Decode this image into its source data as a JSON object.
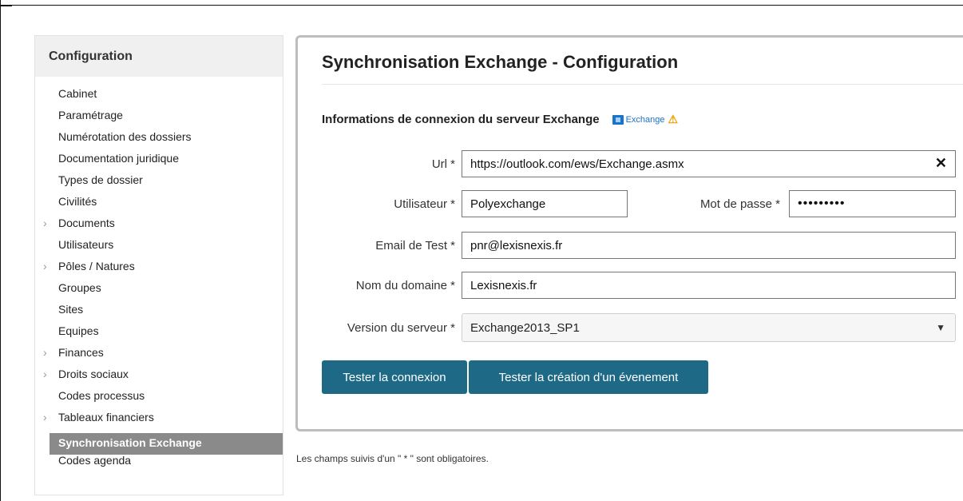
{
  "sidebar": {
    "title": "Configuration",
    "items": [
      {
        "label": "Cabinet",
        "chevron": false
      },
      {
        "label": "Paramétrage",
        "chevron": false
      },
      {
        "label": "Numérotation des dossiers",
        "chevron": false
      },
      {
        "label": "Documentation juridique",
        "chevron": false
      },
      {
        "label": "Types de dossier",
        "chevron": false
      },
      {
        "label": "Civilités",
        "chevron": false
      },
      {
        "label": "Documents",
        "chevron": true
      },
      {
        "label": "Utilisateurs",
        "chevron": false
      },
      {
        "label": "Pôles / Natures",
        "chevron": true
      },
      {
        "label": "Groupes",
        "chevron": false
      },
      {
        "label": "Sites",
        "chevron": false
      },
      {
        "label": "Equipes",
        "chevron": false
      },
      {
        "label": "Finances",
        "chevron": true
      },
      {
        "label": "Droits sociaux",
        "chevron": true
      },
      {
        "label": "Codes processus",
        "chevron": false
      },
      {
        "label": "Tableaux financiers",
        "chevron": true
      },
      {
        "label": "Synchronisation Exchange",
        "chevron": false,
        "active": true
      },
      {
        "label": "Codes agenda",
        "chevron": false
      }
    ]
  },
  "main": {
    "title": "Synchronisation Exchange - Configuration",
    "section_title": "Informations de connexion du serveur Exchange",
    "exchange_logo_text": "Exchange",
    "warning_icon": "warning-triangle-icon",
    "fields": {
      "url": {
        "label": "Url *",
        "value": "https://outlook.com/ews/Exchange.asmx",
        "clear_icon": "✕"
      },
      "user": {
        "label": "Utilisateur *",
        "value": "Polyexchange"
      },
      "password": {
        "label": "Mot de passe *",
        "value": "•••••••••"
      },
      "email": {
        "label": "Email de Test *",
        "value": "pnr@lexisnexis.fr"
      },
      "domain": {
        "label": "Nom du domaine *",
        "value": "Lexisnexis.fr"
      },
      "version": {
        "label": "Version du serveur *",
        "value": "Exchange2013_SP1"
      }
    },
    "buttons": {
      "test_connection": "Tester la connexion",
      "test_event": "Tester la création d'un évenement"
    }
  },
  "footnote": "Les champs suivis d'un \" * \" sont obligatoires.",
  "colors": {
    "button_bg": "#1e6a86",
    "active_item_bg": "#8a8a8a",
    "exchange_blue": "#1a73c8",
    "warning": "#f0a100"
  }
}
